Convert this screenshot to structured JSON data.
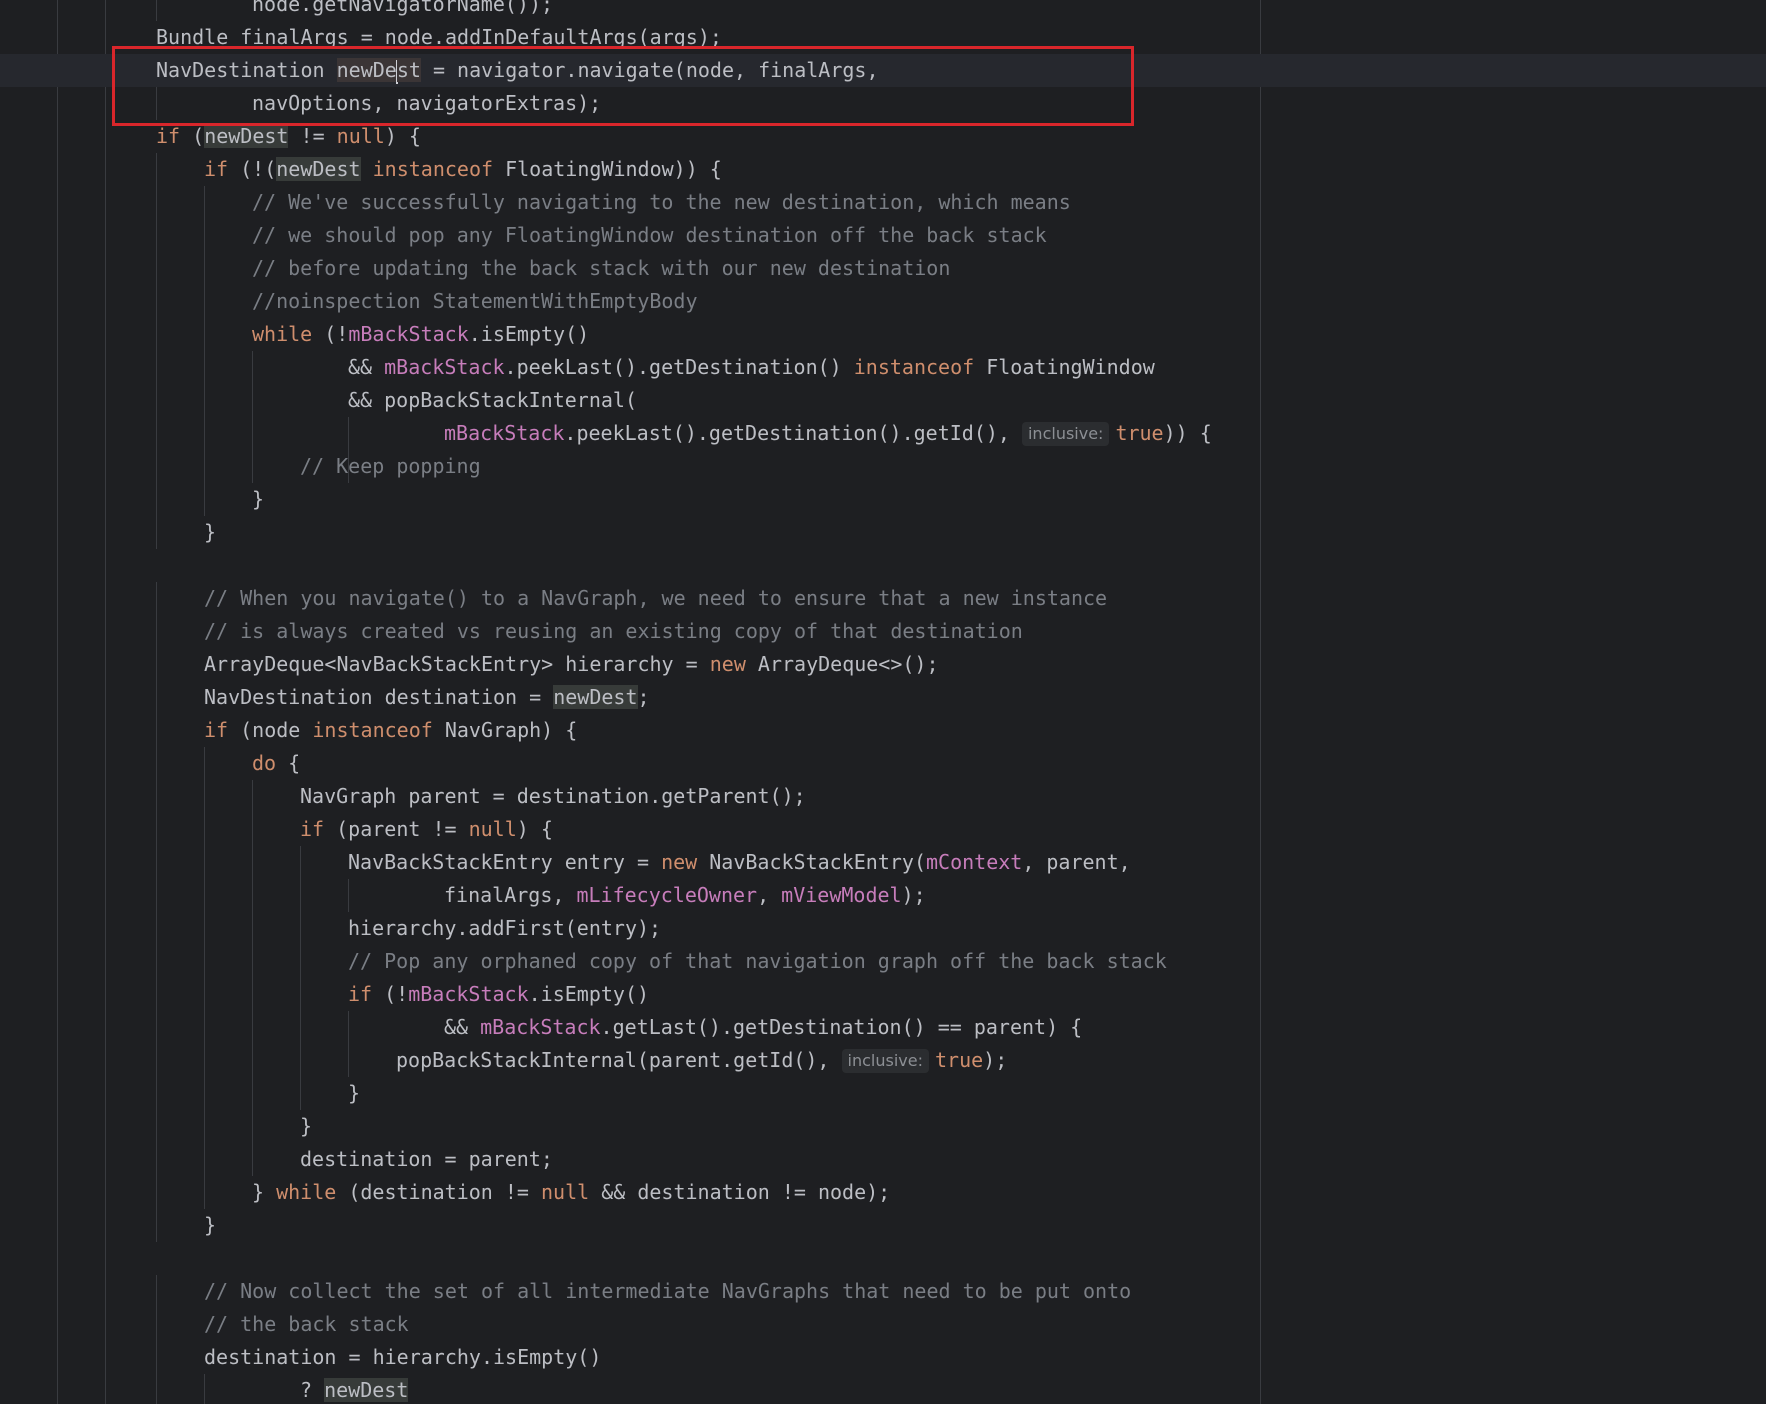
{
  "editor": {
    "language": "java",
    "caret_line": 2,
    "lines": [
      {
        "tokens": [
          {
            "t": "node.getNavigatorName());"
          }
        ]
      },
      {
        "tokens": [
          {
            "t": "Bundle finalArgs = node.addInDefaultArgs(args);"
          }
        ]
      },
      {
        "tokens": [
          {
            "t": "NavDestination "
          },
          {
            "t": "newDe",
            "c": "hl-cur"
          },
          {
            "caret": true
          },
          {
            "t": "st",
            "c": "hl-cur"
          },
          {
            "t": " = navigator.navigate(node, finalArgs,"
          }
        ]
      },
      {
        "tokens": [
          {
            "t": "navOptions, navigatorExtras);"
          }
        ]
      },
      {
        "tokens": [
          {
            "t": "if",
            "c": "kw"
          },
          {
            "t": " ("
          },
          {
            "t": "newDest",
            "c": "hl"
          },
          {
            "t": " != "
          },
          {
            "t": "null",
            "c": "kw"
          },
          {
            "t": ") {"
          }
        ]
      },
      {
        "tokens": [
          {
            "t": "if",
            "c": "kw"
          },
          {
            "t": " (!("
          },
          {
            "t": "newDest",
            "c": "hl"
          },
          {
            "t": " "
          },
          {
            "t": "instanceof",
            "c": "kw"
          },
          {
            "t": " FloatingWindow)) {"
          }
        ]
      },
      {
        "tokens": [
          {
            "t": "// We've successfully navigating to the new destination, which means",
            "c": "comment"
          }
        ]
      },
      {
        "tokens": [
          {
            "t": "// we should pop any FloatingWindow destination off the back stack",
            "c": "comment"
          }
        ]
      },
      {
        "tokens": [
          {
            "t": "// before updating the back stack with our new destination",
            "c": "comment"
          }
        ]
      },
      {
        "tokens": [
          {
            "t": "//noinspection StatementWithEmptyBody",
            "c": "comment"
          }
        ]
      },
      {
        "tokens": [
          {
            "t": "while",
            "c": "kw"
          },
          {
            "t": " (!"
          },
          {
            "t": "mBackStack",
            "c": "field"
          },
          {
            "t": ".isEmpty()"
          }
        ]
      },
      {
        "tokens": [
          {
            "t": "&& "
          },
          {
            "t": "mBackStack",
            "c": "field"
          },
          {
            "t": ".peekLast().getDestination() "
          },
          {
            "t": "instanceof",
            "c": "kw"
          },
          {
            "t": " FloatingWindow"
          }
        ]
      },
      {
        "tokens": [
          {
            "t": "&& popBackStackInternal("
          }
        ]
      },
      {
        "tokens": [
          {
            "t": "mBackStack",
            "c": "field"
          },
          {
            "t": ".peekLast().getDestination().getId(), "
          },
          {
            "hint": "inclusive:"
          },
          {
            "t": "true",
            "c": "kw"
          },
          {
            "t": ")) {"
          }
        ]
      },
      {
        "tokens": [
          {
            "t": "// Keep popping",
            "c": "comment"
          }
        ]
      },
      {
        "tokens": [
          {
            "t": "}"
          }
        ]
      },
      {
        "tokens": [
          {
            "t": "}"
          }
        ]
      },
      {
        "tokens": []
      },
      {
        "tokens": [
          {
            "t": "// When you navigate() to a NavGraph, we need to ensure that a new instance",
            "c": "comment"
          }
        ]
      },
      {
        "tokens": [
          {
            "t": "// is always created vs reusing an existing copy of that destination",
            "c": "comment"
          }
        ]
      },
      {
        "tokens": [
          {
            "t": "ArrayDeque<NavBackStackEntry> hierarchy = "
          },
          {
            "t": "new",
            "c": "kw"
          },
          {
            "t": " ArrayDeque<>();"
          }
        ]
      },
      {
        "tokens": [
          {
            "t": "NavDestination destination = "
          },
          {
            "t": "newDest",
            "c": "hl"
          },
          {
            "t": ";"
          }
        ]
      },
      {
        "tokens": [
          {
            "t": "if",
            "c": "kw"
          },
          {
            "t": " (node "
          },
          {
            "t": "instanceof",
            "c": "kw"
          },
          {
            "t": " NavGraph) {"
          }
        ]
      },
      {
        "tokens": [
          {
            "t": "do",
            "c": "kw"
          },
          {
            "t": " {"
          }
        ]
      },
      {
        "tokens": [
          {
            "t": "NavGraph parent = destination.getParent();"
          }
        ]
      },
      {
        "tokens": [
          {
            "t": "if",
            "c": "kw"
          },
          {
            "t": " (parent != "
          },
          {
            "t": "null",
            "c": "kw"
          },
          {
            "t": ") {"
          }
        ]
      },
      {
        "tokens": [
          {
            "t": "NavBackStackEntry entry = "
          },
          {
            "t": "new",
            "c": "kw"
          },
          {
            "t": " NavBackStackEntry("
          },
          {
            "t": "mContext",
            "c": "field"
          },
          {
            "t": ", parent,"
          }
        ]
      },
      {
        "tokens": [
          {
            "t": "finalArgs, "
          },
          {
            "t": "mLifecycleOwner",
            "c": "field"
          },
          {
            "t": ", "
          },
          {
            "t": "mViewModel",
            "c": "field"
          },
          {
            "t": ");"
          }
        ]
      },
      {
        "tokens": [
          {
            "t": "hierarchy.addFirst(entry);"
          }
        ]
      },
      {
        "tokens": [
          {
            "t": "// Pop any orphaned copy of that navigation graph off the back stack",
            "c": "comment"
          }
        ]
      },
      {
        "tokens": [
          {
            "t": "if",
            "c": "kw"
          },
          {
            "t": " (!"
          },
          {
            "t": "mBackStack",
            "c": "field"
          },
          {
            "t": ".isEmpty()"
          }
        ]
      },
      {
        "tokens": [
          {
            "t": "&& "
          },
          {
            "t": "mBackStack",
            "c": "field"
          },
          {
            "t": ".getLast().getDestination() == parent) {"
          }
        ]
      },
      {
        "tokens": [
          {
            "t": "popBackStackInternal(parent.getId(), "
          },
          {
            "hint": "inclusive:"
          },
          {
            "t": "true",
            "c": "kw"
          },
          {
            "t": ");"
          }
        ]
      },
      {
        "tokens": [
          {
            "t": "}"
          }
        ]
      },
      {
        "tokens": [
          {
            "t": "}"
          }
        ]
      },
      {
        "tokens": [
          {
            "t": "destination = parent;"
          }
        ]
      },
      {
        "tokens": [
          {
            "t": "} "
          },
          {
            "t": "while",
            "c": "kw"
          },
          {
            "t": " (destination != "
          },
          {
            "t": "null",
            "c": "kw"
          },
          {
            "t": " && destination != node);"
          }
        ]
      },
      {
        "tokens": [
          {
            "t": "}"
          }
        ]
      },
      {
        "tokens": []
      },
      {
        "tokens": [
          {
            "t": "// Now collect the set of all intermediate NavGraphs that need to be put onto",
            "c": "comment"
          }
        ]
      },
      {
        "tokens": [
          {
            "t": "// the back stack",
            "c": "comment"
          }
        ]
      },
      {
        "tokens": [
          {
            "t": "destination = hierarchy.isEmpty()"
          }
        ]
      },
      {
        "tokens": [
          {
            "t": "? "
          },
          {
            "t": "newDest",
            "c": "hl"
          }
        ]
      }
    ]
  },
  "colors": {
    "background": "#1e1f22",
    "text": "#bcbec4",
    "keyword": "#cf8e6d",
    "field": "#c77dbb",
    "comment": "#7a7e85",
    "annotation_box": "#d9262b"
  }
}
